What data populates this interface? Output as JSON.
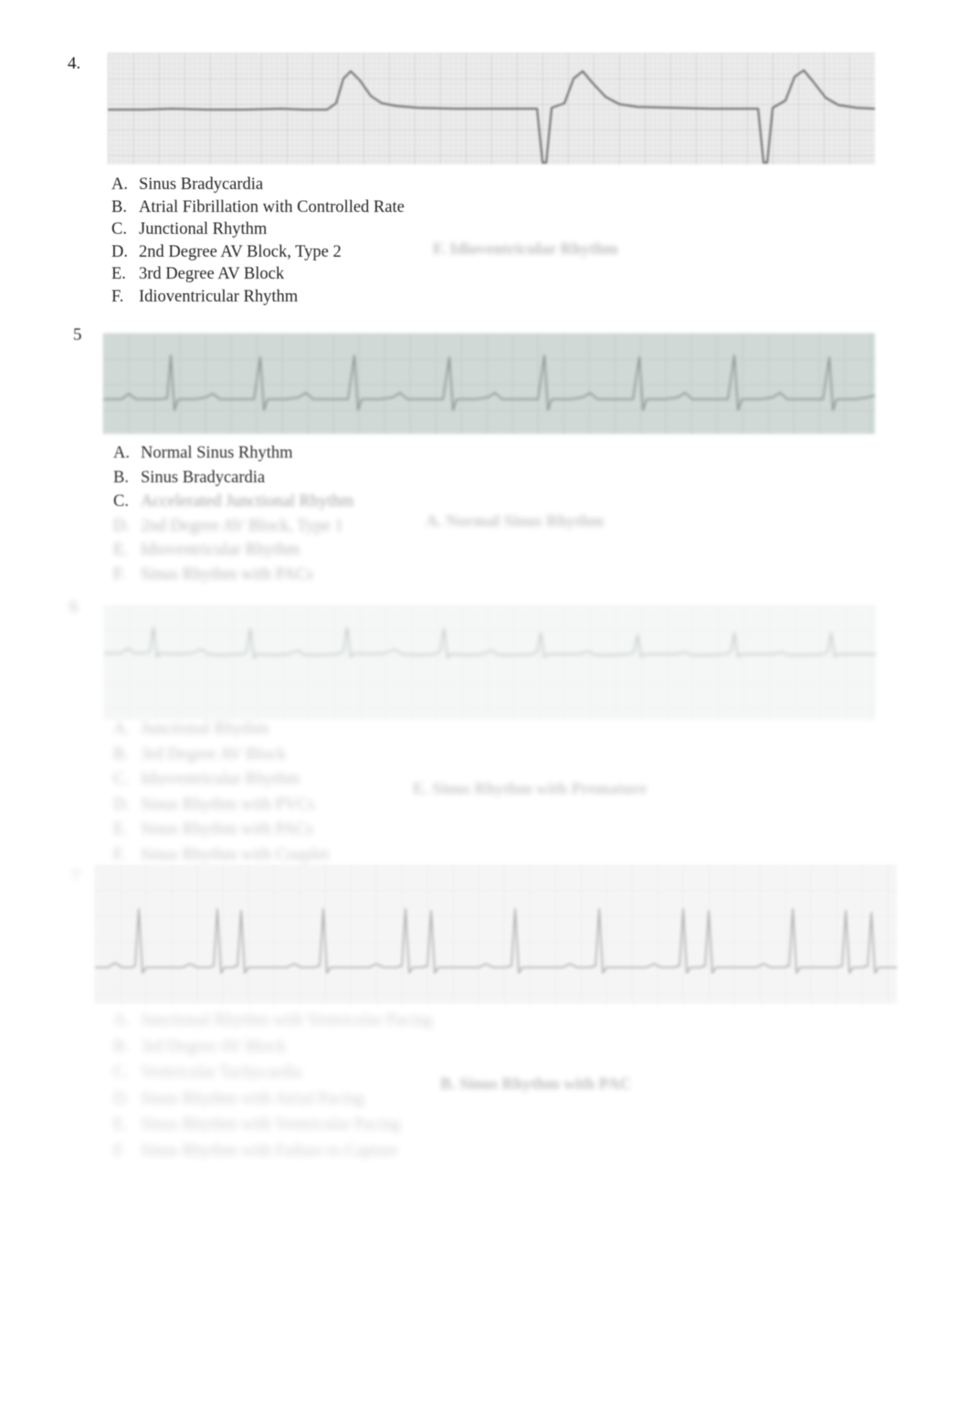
{
  "document": {
    "type": "ecg-rhythm-identification-quiz",
    "page_background": "#ffffff"
  },
  "questions": [
    {
      "number": "4.",
      "strip": {
        "name": "ecg-strip-q4",
        "grid_color": "#c9c9c9",
        "paper_color": "#ededed",
        "trace_color": "#6b6b6b",
        "rhythm_appearance": "wide slow complexes, idioventricular"
      },
      "options": [
        {
          "letter": "A.",
          "text": "Sinus Bradycardia"
        },
        {
          "letter": "B.",
          "text": "Atrial Fibrillation with Controlled Rate"
        },
        {
          "letter": "C.",
          "text": "Junctional Rhythm"
        },
        {
          "letter": "D.",
          "text": "2nd Degree AV Block, Type 2"
        },
        {
          "letter": "E.",
          "text": "3rd Degree AV Block"
        },
        {
          "letter": "F.",
          "text": "Idioventricular Rhythm"
        }
      ],
      "answer": "F. Idioventricular Rhythm"
    },
    {
      "number": "5",
      "strip": {
        "name": "ecg-strip-q5",
        "grid_color": "#a8b8b4",
        "paper_color": "#c5d0cc",
        "trace_color": "#71817d",
        "rhythm_appearance": "regular narrow complexes, normal rate"
      },
      "options": [
        {
          "letter": "A.",
          "text": "Normal Sinus Rhythm"
        },
        {
          "letter": "B.",
          "text": "Sinus Bradycardia"
        },
        {
          "letter": "C.",
          "text": "Accelerated Junctional Rhythm"
        },
        {
          "letter": "D.",
          "text": "2nd Degree AV Block, Type 1"
        },
        {
          "letter": "E.",
          "text": "Idioventricular Rhythm"
        },
        {
          "letter": "F.",
          "text": "Sinus Rhythm with PACs"
        }
      ],
      "answer": "A. Normal Sinus Rhythm"
    },
    {
      "number": "6",
      "strip": {
        "name": "ecg-strip-q6",
        "grid_color": "#cfd8d4",
        "paper_color": "#eef2f0",
        "trace_color": "#8f9a96",
        "rhythm_appearance": "narrow complexes, slightly irregular"
      },
      "options": [
        {
          "letter": "A.",
          "text": "Junctional Rhythm"
        },
        {
          "letter": "B.",
          "text": "3rd Degree AV Block"
        },
        {
          "letter": "C.",
          "text": "Idioventricular Rhythm"
        },
        {
          "letter": "D.",
          "text": "Sinus Rhythm with PVCs"
        },
        {
          "letter": "E.",
          "text": "Sinus Rhythm with PACs"
        },
        {
          "letter": "F.",
          "text": "Sinus Rhythm with Couplet"
        }
      ],
      "answer": "E. Sinus Rhythm with Premature"
    },
    {
      "number": "7",
      "strip": {
        "name": "ecg-strip-q7",
        "grid_color": "#d2d2d2",
        "paper_color": "#f1f1f1",
        "trace_color": "#808080",
        "rhythm_appearance": "narrow tall complexes with paired early beats"
      },
      "options": [
        {
          "letter": "A.",
          "text": "Junctional Rhythm with Ventricular Pacing"
        },
        {
          "letter": "B.",
          "text": "3rd Degree AV Block"
        },
        {
          "letter": "C.",
          "text": "Ventricular Tachycardia"
        },
        {
          "letter": "D.",
          "text": "Sinus Rhythm with Atrial Pacing"
        },
        {
          "letter": "E.",
          "text": "Sinus Rhythm with Ventricular Pacing"
        },
        {
          "letter": "F.",
          "text": "Sinus Rhythm with Failure to Capture"
        }
      ],
      "answer": "B. Sinus Rhythm with PAC"
    }
  ]
}
